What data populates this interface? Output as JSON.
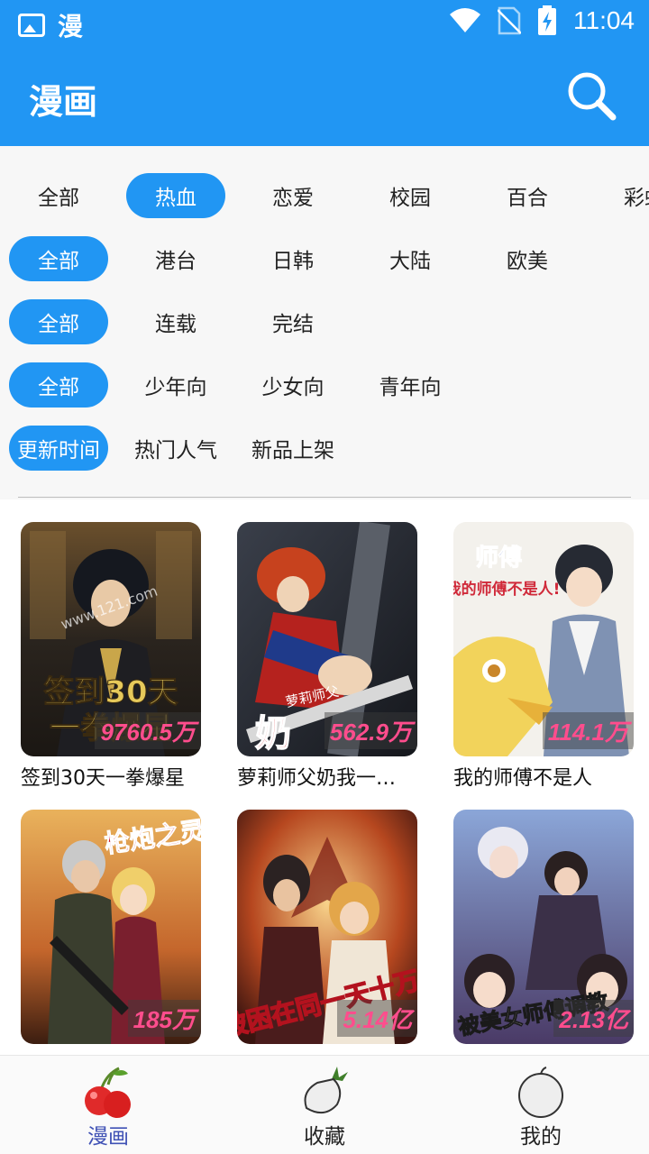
{
  "status_bar": {
    "app_glyph": "漫",
    "time": "11:04"
  },
  "header": {
    "title": "漫画"
  },
  "filters": {
    "genre": [
      "全部",
      "热血",
      "恋爱",
      "校园",
      "百合",
      "彩虹"
    ],
    "genre_active": 1,
    "region": [
      "全部",
      "港台",
      "日韩",
      "大陆",
      "欧美"
    ],
    "region_active": 0,
    "status": [
      "全部",
      "连载",
      "完结"
    ],
    "status_active": 0,
    "audience": [
      "全部",
      "少年向",
      "少女向",
      "青年向"
    ],
    "audience_active": 0,
    "sort": [
      "更新时间",
      "热门人气",
      "新品上架"
    ],
    "sort_active": 0
  },
  "comics": [
    {
      "title": "签到30天一拳爆星",
      "views": "9760.5万",
      "cover_text": "签到30天一拳爆星",
      "watermark": "www.121.com"
    },
    {
      "title": "萝莉师父奶我一…",
      "views": "562.9万",
      "cover_text": "萝莉师父"
    },
    {
      "title": "我的师傅不是人",
      "views": "114.1万",
      "cover_text": "我的师傅不是人!"
    },
    {
      "title": "",
      "views": "185万",
      "cover_text": "枪炮之灵"
    },
    {
      "title": "",
      "views": "5.14亿",
      "cover_text": "我被困在同一天十万年"
    },
    {
      "title": "",
      "views": "2.13亿",
      "cover_text": "被美女师傅调教"
    }
  ],
  "bottom_nav": [
    {
      "label": "漫画",
      "icon": "cherry-icon",
      "active": true
    },
    {
      "label": "收藏",
      "icon": "radish-icon",
      "active": false
    },
    {
      "label": "我的",
      "icon": "melon-icon",
      "active": false
    }
  ],
  "colors": {
    "primary": "#2196f3",
    "views_text": "#ff4d8d",
    "nav_active": "#3f51b5"
  }
}
